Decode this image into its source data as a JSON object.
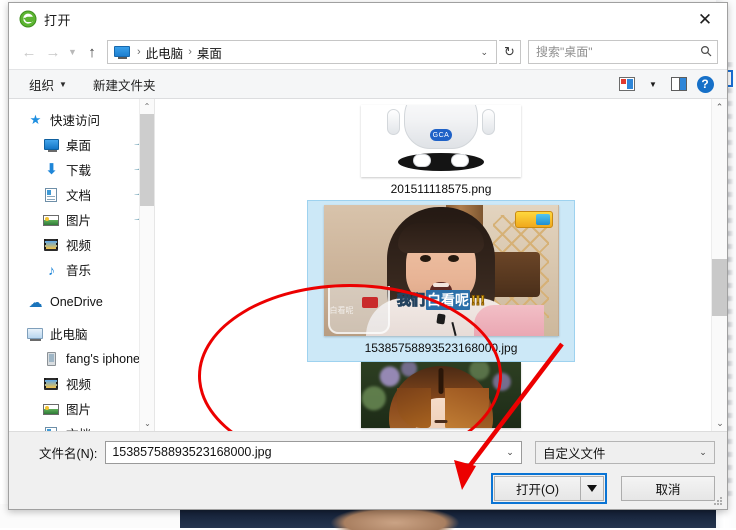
{
  "window": {
    "title": "打开",
    "title_icon": "green-e-browser-icon",
    "close_label": "✕"
  },
  "addressbar": {
    "back_icon": "arrow-left-icon",
    "forward_icon": "arrow-right-icon",
    "recent_icon": "chevron-down-icon",
    "up_icon": "arrow-up-icon",
    "crumbs": [
      "此电脑",
      "桌面"
    ],
    "separator": "›",
    "dropdown_icon": "chevron-down-icon",
    "refresh_icon": "↻",
    "refresh_label": "↻"
  },
  "search": {
    "placeholder": "搜索\"桌面\"",
    "value": "",
    "icon": "search-icon"
  },
  "toolbar": {
    "organize_label": "组织",
    "newfolder_label": "新建文件夹",
    "caret": "▼",
    "view_icon": "view-options-icon",
    "view_caret": "▼",
    "preview_icon": "preview-pane-icon",
    "help_icon": "help-icon",
    "help_glyph": "?"
  },
  "sidebar": {
    "scroll_up": "⌃",
    "scroll_down": "⌄",
    "items": [
      {
        "label": "快速访问",
        "icon": "star-icon",
        "level": 0,
        "pinned": false
      },
      {
        "label": "桌面",
        "icon": "desktop-icon",
        "level": 1,
        "pinned": true
      },
      {
        "label": "下载",
        "icon": "download-icon",
        "level": 1,
        "pinned": true
      },
      {
        "label": "文档",
        "icon": "documents-icon",
        "level": 1,
        "pinned": true
      },
      {
        "label": "图片",
        "icon": "pictures-icon",
        "level": 1,
        "pinned": true
      },
      {
        "label": "视频",
        "icon": "videos-icon",
        "level": 1,
        "pinned": false
      },
      {
        "label": "音乐",
        "icon": "music-icon",
        "level": 1,
        "pinned": false
      },
      {
        "label": "OneDrive",
        "icon": "onedrive-cloud-icon",
        "level": 0,
        "pinned": false
      },
      {
        "label": "此电脑",
        "icon": "this-pc-icon",
        "level": 0,
        "pinned": false
      },
      {
        "label": "fang's iphone",
        "icon": "phone-icon",
        "level": 1,
        "pinned": false
      },
      {
        "label": "视频",
        "icon": "videos-icon",
        "level": 1,
        "pinned": false
      },
      {
        "label": "图片",
        "icon": "pictures-icon",
        "level": 1,
        "pinned": false
      },
      {
        "label": "文档",
        "icon": "documents-icon",
        "level": 1,
        "pinned": false
      }
    ],
    "pin_glyph": "📌"
  },
  "filelist": {
    "scroll_up": "⌃",
    "scroll_down": "⌄",
    "items": [
      {
        "name": "201511118575.png",
        "thumb": "white-robot-image",
        "selected": false
      },
      {
        "name": "15385758893523168000.jpg",
        "thumb": "girl-photo-image",
        "selected": true
      },
      {
        "name": "",
        "thumb": "woman-photo-image",
        "selected": false
      }
    ],
    "subtitle_text": {
      "prefix": "我们",
      "highlight": "白看呢",
      "suffix": "!!!"
    }
  },
  "footer": {
    "filename_label": "文件名(N):",
    "filename_value": "15385758893523168000.jpg",
    "filename_caret": "⌄",
    "filter_value": "自定义文件",
    "filter_caret": "⌄",
    "open_label": "打开(O)",
    "open_dropdown_icon": "triangle-down-icon",
    "cancel_label": "取消"
  },
  "colors": {
    "accent_focus": "#0a74d4",
    "selection_fill": "#cce8f7",
    "selection_border": "#9ed2ef",
    "annotation_red": "#ec0000",
    "help_blue": "#1670c8"
  }
}
